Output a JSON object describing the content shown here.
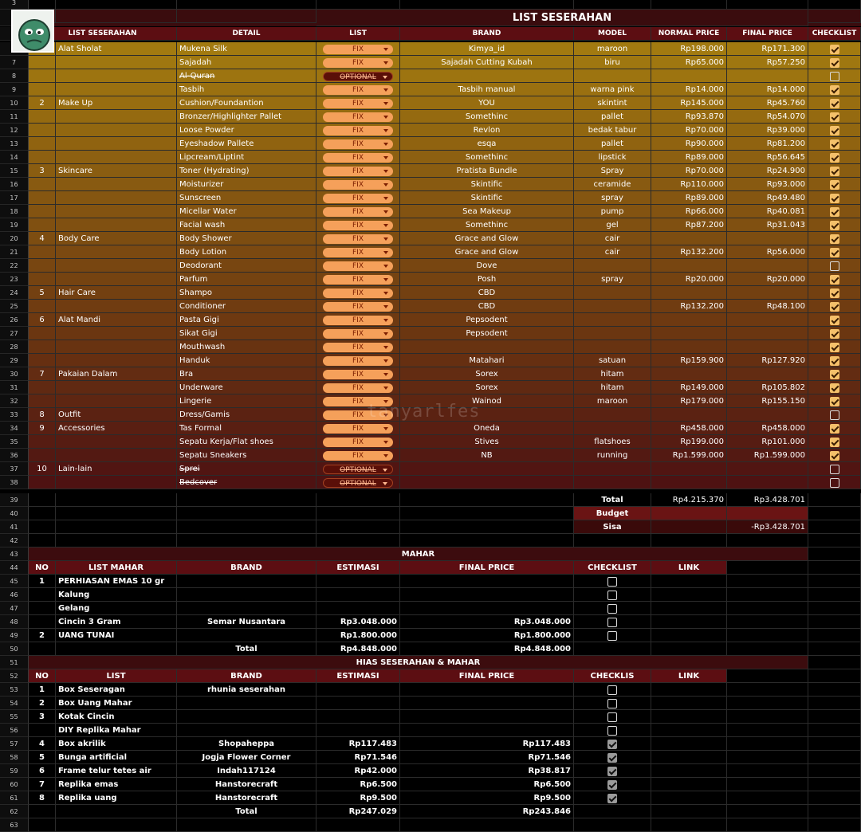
{
  "row_numbers": {
    "r3": "3",
    "r4": "4",
    "r6": "6",
    "r39": "39",
    "r40": "40",
    "r41": "41",
    "r42": "42",
    "r43": "43",
    "r44": "44",
    "r51": "51",
    "r52": "52",
    "r62": "62",
    "r63": "63"
  },
  "seserahan": {
    "title": "LIST SESERAHAN",
    "headers": [
      "LIST SESERAHAN",
      "DETAIL",
      "LIST",
      "BRAND",
      "MODEL",
      "NORMAL PRICE",
      "FINAL PRICE",
      "CHECKLIST"
    ],
    "rows": [
      {
        "rn": "7",
        "no": "",
        "cat": "Alat Sholat",
        "detail": "Mukena Silk",
        "list": "FIX",
        "brand": "Kimya_id",
        "model": "maroon",
        "normal": "Rp198.000",
        "final": "Rp171.300",
        "check": true
      },
      {
        "rn": "7",
        "no": "",
        "cat": "",
        "detail": "Sajadah",
        "list": "FIX",
        "brand": "Sajadah Cutting Kubah",
        "model": "biru",
        "normal": "Rp65.000",
        "final": "Rp57.250",
        "check": true
      },
      {
        "rn": "8",
        "no": "",
        "cat": "",
        "detail": "Al-Quran",
        "list": "OPTIONAL",
        "brand": "",
        "model": "",
        "normal": "",
        "final": "",
        "check": false
      },
      {
        "rn": "9",
        "no": "",
        "cat": "",
        "detail": "Tasbih",
        "list": "FIX",
        "brand": "Tasbih manual",
        "model": "warna pink",
        "normal": "Rp14.000",
        "final": "Rp14.000",
        "check": true
      },
      {
        "rn": "10",
        "no": "2",
        "cat": "Make Up",
        "detail": "Cushion/Foundantion",
        "list": "FIX",
        "brand": "YOU",
        "model": "skintint",
        "normal": "Rp145.000",
        "final": "Rp45.760",
        "check": true
      },
      {
        "rn": "11",
        "no": "",
        "cat": "",
        "detail": "Bronzer/Highlighter Pallet",
        "list": "FIX",
        "brand": "Somethinc",
        "model": "pallet",
        "normal": "Rp93.870",
        "final": "Rp54.070",
        "check": true
      },
      {
        "rn": "12",
        "no": "",
        "cat": "",
        "detail": "Loose Powder",
        "list": "FIX",
        "brand": "Revlon",
        "model": "bedak tabur",
        "normal": "Rp70.000",
        "final": "Rp39.000",
        "check": true
      },
      {
        "rn": "13",
        "no": "",
        "cat": "",
        "detail": "Eyeshadow Pallete",
        "list": "FIX",
        "brand": "esqa",
        "model": "pallet",
        "normal": "Rp90.000",
        "final": "Rp81.200",
        "check": true
      },
      {
        "rn": "14",
        "no": "",
        "cat": "",
        "detail": "Lipcream/Liptint",
        "list": "FIX",
        "brand": "Somethinc",
        "model": "lipstick",
        "normal": "Rp89.000",
        "final": "Rp56.645",
        "check": true
      },
      {
        "rn": "15",
        "no": "3",
        "cat": "Skincare",
        "detail": "Toner (Hydrating)",
        "list": "FIX",
        "brand": "Pratista Bundle",
        "model": "Spray",
        "normal": "Rp70.000",
        "final": "Rp24.900",
        "check": true
      },
      {
        "rn": "16",
        "no": "",
        "cat": "",
        "detail": "Moisturizer",
        "list": "FIX",
        "brand": "Skintific",
        "model": "ceramide",
        "normal": "Rp110.000",
        "final": "Rp93.000",
        "check": true
      },
      {
        "rn": "17",
        "no": "",
        "cat": "",
        "detail": "Sunscreen",
        "list": "FIX",
        "brand": "Skintific",
        "model": "spray",
        "normal": "Rp89.000",
        "final": "Rp49.480",
        "check": true
      },
      {
        "rn": "18",
        "no": "",
        "cat": "",
        "detail": "Micellar Water",
        "list": "FIX",
        "brand": "Sea Makeup",
        "model": "pump",
        "normal": "Rp66.000",
        "final": "Rp40.081",
        "check": true
      },
      {
        "rn": "19",
        "no": "",
        "cat": "",
        "detail": "Facial wash",
        "list": "FIX",
        "brand": "Somethinc",
        "model": "gel",
        "normal": "Rp87.200",
        "final": "Rp31.043",
        "check": true
      },
      {
        "rn": "20",
        "no": "4",
        "cat": "Body Care",
        "detail": "Body Shower",
        "list": "FIX",
        "brand": "Grace and Glow",
        "model": "cair",
        "normal": "",
        "final": "",
        "check": true
      },
      {
        "rn": "21",
        "no": "",
        "cat": "",
        "detail": "Body Lotion",
        "list": "FIX",
        "brand": "Grace and Glow",
        "model": "cair",
        "normal": "Rp132.200",
        "final": "Rp56.000",
        "check": true
      },
      {
        "rn": "22",
        "no": "",
        "cat": "",
        "detail": "Deodorant",
        "list": "FIX",
        "brand": "Dove",
        "model": "",
        "normal": "",
        "final": "",
        "check": false
      },
      {
        "rn": "23",
        "no": "",
        "cat": "",
        "detail": "Parfum",
        "list": "FIX",
        "brand": "Posh",
        "model": "spray",
        "normal": "Rp20.000",
        "final": "Rp20.000",
        "check": true
      },
      {
        "rn": "24",
        "no": "5",
        "cat": "Hair Care",
        "detail": "Shampo",
        "list": "FIX",
        "brand": "CBD",
        "model": "",
        "normal": "",
        "final": "",
        "check": true
      },
      {
        "rn": "25",
        "no": "",
        "cat": "",
        "detail": "Conditioner",
        "list": "FIX",
        "brand": "CBD",
        "model": "",
        "normal": "Rp132.200",
        "final": "Rp48.100",
        "check": true
      },
      {
        "rn": "26",
        "no": "6",
        "cat": "Alat Mandi",
        "detail": "Pasta Gigi",
        "list": "FIX",
        "brand": "Pepsodent",
        "model": "",
        "normal": "",
        "final": "",
        "check": true
      },
      {
        "rn": "27",
        "no": "",
        "cat": "",
        "detail": "Sikat Gigi",
        "list": "FIX",
        "brand": "Pepsodent",
        "model": "",
        "normal": "",
        "final": "",
        "check": true
      },
      {
        "rn": "28",
        "no": "",
        "cat": "",
        "detail": "Mouthwash",
        "list": "FIX",
        "brand": "",
        "model": "",
        "normal": "",
        "final": "",
        "check": true
      },
      {
        "rn": "29",
        "no": "",
        "cat": "",
        "detail": "Handuk",
        "list": "FIX",
        "brand": "Matahari",
        "model": "satuan",
        "normal": "Rp159.900",
        "final": "Rp127.920",
        "check": true
      },
      {
        "rn": "30",
        "no": "7",
        "cat": "Pakaian Dalam",
        "detail": "Bra",
        "list": "FIX",
        "brand": "Sorex",
        "model": "hitam",
        "normal": "",
        "final": "",
        "check": true
      },
      {
        "rn": "31",
        "no": "",
        "cat": "",
        "detail": "Underware",
        "list": "FIX",
        "brand": "Sorex",
        "model": "hitam",
        "normal": "Rp149.000",
        "final": "Rp105.802",
        "check": true
      },
      {
        "rn": "32",
        "no": "",
        "cat": "",
        "detail": "Lingerie",
        "list": "FIX",
        "brand": "Wainod",
        "model": "maroon",
        "normal": "Rp179.000",
        "final": "Rp155.150",
        "check": true
      },
      {
        "rn": "33",
        "no": "8",
        "cat": "Outfit",
        "detail": "Dress/Gamis",
        "list": "FIX",
        "brand": "",
        "model": "",
        "normal": "",
        "final": "",
        "check": false
      },
      {
        "rn": "34",
        "no": "9",
        "cat": "Accessories",
        "detail": "Tas Formal",
        "list": "FIX",
        "brand": "Oneda",
        "model": "",
        "normal": "Rp458.000",
        "final": "Rp458.000",
        "check": true
      },
      {
        "rn": "35",
        "no": "",
        "cat": "",
        "detail": "Sepatu Kerja/Flat shoes",
        "list": "FIX",
        "brand": "Stives",
        "model": "flatshoes",
        "normal": "Rp199.000",
        "final": "Rp101.000",
        "check": true
      },
      {
        "rn": "36",
        "no": "",
        "cat": "",
        "detail": "Sepatu Sneakers",
        "list": "FIX",
        "brand": "NB",
        "model": "running",
        "normal": "Rp1.599.000",
        "final": "Rp1.599.000",
        "check": true
      },
      {
        "rn": "37",
        "no": "10",
        "cat": "Lain-lain",
        "detail": "Sprei",
        "list": "OPTIONAL",
        "brand": "",
        "model": "",
        "normal": "",
        "final": "",
        "check": false
      },
      {
        "rn": "38",
        "no": "",
        "cat": "",
        "detail": "Bedcover",
        "list": "OPTIONAL",
        "brand": "",
        "model": "",
        "normal": "",
        "final": "",
        "check": false
      }
    ],
    "total_label": "Total",
    "total_normal": "Rp4.215.370",
    "total_final": "Rp3.428.701",
    "budget_label": "Budget",
    "sisa_label": "Sisa",
    "sisa_value": "-Rp3.428.701"
  },
  "mahar": {
    "title": "MAHAR",
    "headers": [
      "NO",
      "LIST MAHAR",
      "BRAND",
      "ESTIMASI",
      "FINAL PRICE",
      "CHECKLIST",
      "LINK"
    ],
    "rows": [
      {
        "rn": "45",
        "no": "1",
        "item": "PERHIASAN EMAS 10 gr",
        "brand": "",
        "est": "",
        "final": "",
        "check": false
      },
      {
        "rn": "46",
        "no": "",
        "item": "Kalung",
        "brand": "",
        "est": "",
        "final": "",
        "check": false
      },
      {
        "rn": "47",
        "no": "",
        "item": "Gelang",
        "brand": "",
        "est": "",
        "final": "",
        "check": false
      },
      {
        "rn": "48",
        "no": "",
        "item": "Cincin 3 Gram",
        "brand": "Semar Nusantara",
        "est": "Rp3.048.000",
        "final": "Rp3.048.000",
        "check": false
      },
      {
        "rn": "49",
        "no": "2",
        "item": "UANG TUNAI",
        "brand": "",
        "est": "Rp1.800.000",
        "final": "Rp1.800.000",
        "check": false
      }
    ],
    "total_rn": "50",
    "total_label": "Total",
    "total_est": "Rp4.848.000",
    "total_final": "Rp4.848.000"
  },
  "hias": {
    "title": "HIAS SESERAHAN & MAHAR",
    "headers": [
      "NO",
      "LIST",
      "BRAND",
      "ESTIMASI",
      "FINAL PRICE",
      "CHECKLIS",
      "LINK"
    ],
    "rows": [
      {
        "rn": "53",
        "no": "1",
        "item": "Box Seseragan",
        "brand": "rhunia seserahan",
        "est": "",
        "final": "",
        "check": false
      },
      {
        "rn": "54",
        "no": "2",
        "item": "Box Uang Mahar",
        "brand": "",
        "est": "",
        "final": "",
        "check": false
      },
      {
        "rn": "55",
        "no": "3",
        "item": "Kotak Cincin",
        "brand": "",
        "est": "",
        "final": "",
        "check": false
      },
      {
        "rn": "56",
        "no": "",
        "item": "DIY Replika Mahar",
        "brand": "",
        "est": "",
        "final": "",
        "check": false
      },
      {
        "rn": "57",
        "no": "4",
        "item": "Box akrilik",
        "brand": "Shopaheppa",
        "est": "Rp117.483",
        "final": "Rp117.483",
        "check": true
      },
      {
        "rn": "58",
        "no": "5",
        "item": "Bunga artificial",
        "brand": "Jogja Flower Corner",
        "est": "Rp71.546",
        "final": "Rp71.546",
        "check": true
      },
      {
        "rn": "59",
        "no": "6",
        "item": "Frame telur tetes air",
        "brand": "Indah117124",
        "est": "Rp42.000",
        "final": "Rp38.817",
        "check": true
      },
      {
        "rn": "60",
        "no": "7",
        "item": "Replika emas",
        "brand": "Hanstorecraft",
        "est": "Rp6.500",
        "final": "Rp6.500",
        "check": true
      },
      {
        "rn": "61",
        "no": "8",
        "item": "Replika uang",
        "brand": "Hanstorecraft",
        "est": "Rp9.500",
        "final": "Rp9.500",
        "check": true
      }
    ],
    "total_label": "Total",
    "total_est": "Rp247.029",
    "total_final": "Rp243.846"
  },
  "watermark": "tanyarlfes",
  "colors": {
    "header_red": "#5c0e12",
    "row_top": "#a27a10",
    "row_bottom": "#5a1414",
    "pill_fix": "#f5a05a",
    "check_on": "#f4c06a"
  }
}
